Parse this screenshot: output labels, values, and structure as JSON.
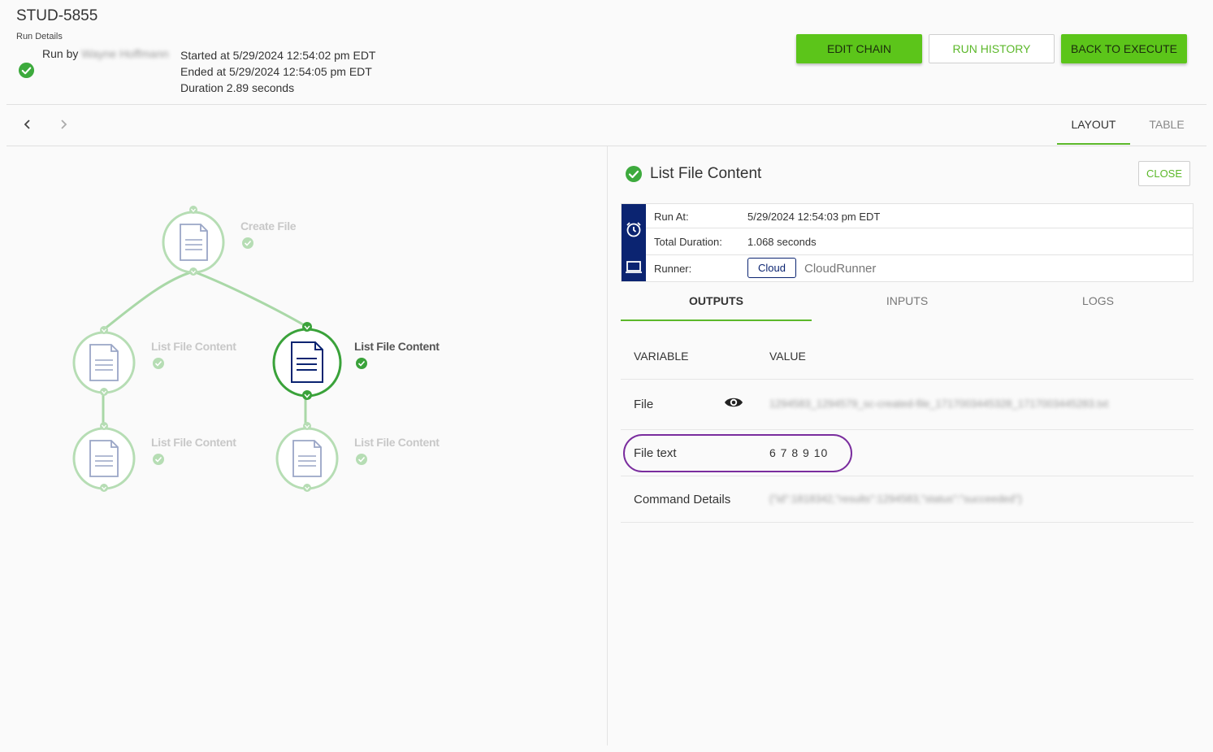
{
  "header": {
    "title": "STUD-5855",
    "subtitle": "Run Details",
    "run_by_label": "Run by",
    "run_by_user": "Wayne Hoffmann",
    "started": "Started at 5/29/2024 12:54:02 pm EDT",
    "ended": "Ended at 5/29/2024 12:54:05 pm EDT",
    "duration": "Duration 2.89 seconds",
    "buttons": {
      "edit_chain": "EDIT CHAIN",
      "run_history": "RUN HISTORY",
      "back_to_execute": "BACK TO EXECUTE"
    }
  },
  "view_tabs": {
    "layout": "LAYOUT",
    "table": "TABLE",
    "active": "LAYOUT"
  },
  "graph": {
    "nodes": [
      {
        "label": "Create File",
        "status": "success",
        "selected": false
      },
      {
        "label": "List File Content",
        "status": "success",
        "selected": false
      },
      {
        "label": "List File Content",
        "status": "success",
        "selected": true
      },
      {
        "label": "List File Content",
        "status": "success",
        "selected": false
      },
      {
        "label": "List File Content",
        "status": "success",
        "selected": false
      }
    ]
  },
  "panel": {
    "title": "List File Content",
    "close": "CLOSE",
    "run_at_label": "Run At:",
    "run_at": "5/29/2024 12:54:03 pm EDT",
    "total_duration_label": "Total Duration:",
    "total_duration": "1.068 seconds",
    "runner_label": "Runner:",
    "runner_type": "Cloud",
    "runner_name": "CloudRunner",
    "tabs": {
      "outputs": "OUTPUTS",
      "inputs": "INPUTS",
      "logs": "LOGS",
      "active": "OUTPUTS"
    },
    "table": {
      "col_variable": "VARIABLE",
      "col_value": "VALUE",
      "rows": [
        {
          "name": "File",
          "value": "1294583_1294579_sc-created-file_1717003445328_1717003445283.txt"
        },
        {
          "name": "File text",
          "value": "6 7 8 9 10"
        },
        {
          "name": "Command Details",
          "value": "{\"id\":1818342,\"results\":1294583,\"status\":\"succeeded\"}"
        }
      ]
    }
  },
  "colors": {
    "accent_green": "#5cc51a",
    "success_green": "#3daa3d",
    "navy": "#0b2471",
    "highlight_purple": "#7a2d9e"
  }
}
